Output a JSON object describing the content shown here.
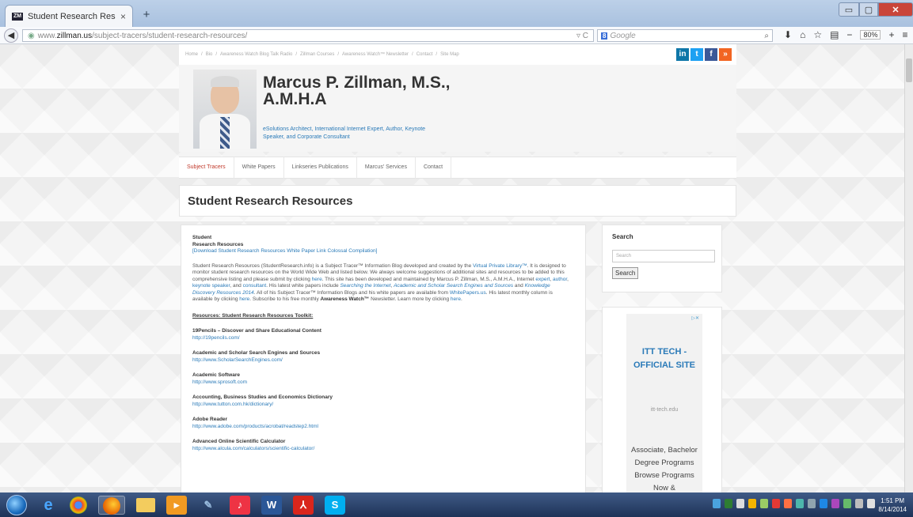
{
  "browser": {
    "tab_title": "Student Research Resource...",
    "tab_close": "×",
    "new_tab": "+",
    "favicon_text": "ZM",
    "window_controls": {
      "minimize": "▭",
      "maximize": "▢",
      "close": "✕"
    },
    "url_prefix": "www.",
    "url_host": "zillman.us",
    "url_path": "/subject-tracers/student-research-resources/",
    "url_icons": "▿ C",
    "search_engine_badge": "8",
    "search_placeholder": "Google",
    "search_icon": "⌕",
    "zoom_level": "80%",
    "toolbar_icons": {
      "download": "⬇",
      "home": "⌂",
      "bookmark": "☆",
      "reader": "▤",
      "zoom_out": "−",
      "zoom_in": "+",
      "menu": "≡"
    }
  },
  "site": {
    "top_links": [
      "Home",
      "/",
      "Bio",
      "/",
      "Awareness Watch Blog Talk Radio",
      "/",
      "Zillman Courses",
      "/",
      "Awareness Watch™ Newsletter",
      "/",
      "Contact",
      "/",
      "Site Map"
    ],
    "social": {
      "linkedin": "in",
      "twitter": "t",
      "facebook": "f",
      "rss": "»"
    },
    "name": "Marcus P. Zillman, M.S., A.M.H.A",
    "tagline": "eSolutions Architect, International Internet Expert, Author, Keynote Speaker, and Corporate Consultant",
    "menu": [
      "Subject Tracers",
      "White Papers",
      "Linkseries Publications",
      "Marcus' Services",
      "Contact"
    ],
    "page_title": "Student Research Resources",
    "content": {
      "heading_line1": "Student",
      "heading_line2": "Research Resources",
      "download_link": "[Download Student Research Resources White Paper Link Colossal Compilation]",
      "intro_1": "Student Research Resources (StudentResearch.info) is a Subject Tracer™ Information Blog developed and created by the ",
      "intro_link_vpl": "Virtual Private Library™",
      "intro_2": ". It is designed to monitor student research resources on the World Wide Web and listed below. We always welcome suggestions of additional sites and resources to be added to this comprehensive listing and please submit by clicking ",
      "intro_link_here1": "here",
      "intro_3": ". This site has been developed and maintained by Marcus P. Zillman, M.S., A.M.H.A., Internet ",
      "intro_link_expert": "expert",
      "intro_4": ", ",
      "intro_link_author": "author",
      "intro_link_keynote": "keynote speaker",
      "intro_5": ", and ",
      "intro_link_consultant": "consultant",
      "intro_6": ". His latest white papers include ",
      "intro_link_wp1": "Searching the Internet",
      "intro_link_wp2": "Academic and Scholar Search Engines and Sources",
      "intro_7": " and ",
      "intro_link_wp3": "Knowledge Discovery Resources 2014",
      "intro_8": ". All of his Subject Tracer™ Information Blogs and his white papers are available from ",
      "intro_link_wpus": "WhitePapers.us",
      "intro_9": ". His latest monthly column is available by clicking ",
      "intro_link_here2": "here",
      "intro_10": ". Subscribe to his free monthly ",
      "intro_newsletter": "Awareness Watch™",
      "intro_11": " Newsletter. Learn more by clicking ",
      "intro_link_here3": "here",
      "intro_end": ".",
      "resources_heading": "Resources: Student Research Resources Toolkit:",
      "resources": [
        {
          "title": "19Pencils – Discover and Share Educational Content",
          "url": "http://19pencils.com/"
        },
        {
          "title": "Academic and Scholar Search Engines and Sources",
          "url": "http://www.ScholarSearchEngines.com/"
        },
        {
          "title": "Academic Software",
          "url": "http://www.sprosoft.com"
        },
        {
          "title": "Accounting, Business Studies and Economics Dictionary",
          "url": "http://www.tutton.com.hk/dictionary/"
        },
        {
          "title": "Adobe Reader",
          "url": "http://www.adobe.com/products/acrobat/readstep2.html"
        },
        {
          "title": "Advanced Online Scientific Calculator",
          "url": "http://www.alcula.com/calculators/scientific-calculator/"
        }
      ]
    },
    "sidebar": {
      "search_title": "Search",
      "search_placeholder": "Search",
      "search_button": "Search",
      "ad_choices": "▷✕",
      "ad_title": "ITT TECH - OFFICIAL SITE",
      "ad_domain": "itt-tech.edu",
      "ad_body": "Associate, Bachelor Degree Programs Browse Programs Now &"
    }
  },
  "taskbar": {
    "icons": [
      "internet-explorer",
      "chrome",
      "firefox",
      "file-explorer",
      "media-player",
      "paint",
      "itunes",
      "word",
      "acrobat",
      "skype"
    ],
    "word_label": "W",
    "pdf_label": "⅄",
    "skype_label": "S",
    "time": "1:51 PM",
    "date": "8/14/2014"
  },
  "colors": {
    "link": "#2a7ab8",
    "active_menu": "#c0392b",
    "taskbar": "#1e3358"
  }
}
